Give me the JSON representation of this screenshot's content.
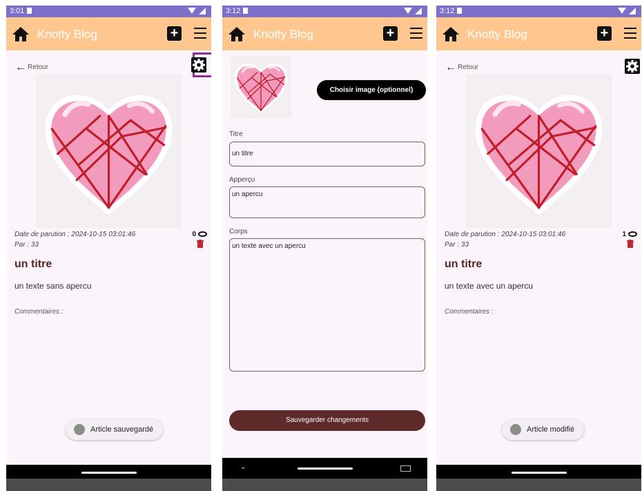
{
  "colors": {
    "status_bar": "#7b6fc8",
    "app_bar": "#fdc78f",
    "title_dark": "#5b2424",
    "save_button": "#5e2a29",
    "highlight": "#8e2d96"
  },
  "app": {
    "name": "Knotty Blog",
    "home_icon": "home-icon",
    "add_icon": "add-square-icon",
    "menu_icon": "hamburger-menu-icon"
  },
  "screens": [
    {
      "status_time": "3:01",
      "back_label": "Retour",
      "date_label": "Date de parution : 2024-10-15 03:01:46",
      "author_label": "Par : 33",
      "view_count": "0",
      "article_title": "un titre",
      "article_body": "un texte sans apercu",
      "comments_label": "Commentaires :",
      "toast": "Article sauvegardé"
    },
    {
      "status_time": "3:12",
      "choose_image": "Choisir image (optionnel)",
      "title_label": "Titre",
      "title_value": "un titre",
      "preview_label": "Apperçu",
      "preview_value": "un apercu",
      "body_label": "Corps",
      "body_value": "un texte avec un apercu",
      "save_button": "Sauvegarder changements"
    },
    {
      "status_time": "3:12",
      "back_label": "Retour",
      "date_label": "Date de parution : 2024-10-15 03:01:46",
      "author_label": "Par : 33",
      "view_count": "1",
      "article_title": "un titre",
      "article_body": "un texte avec un apercu",
      "comments_label": "Commentaires :",
      "toast": "Article modifié"
    }
  ]
}
